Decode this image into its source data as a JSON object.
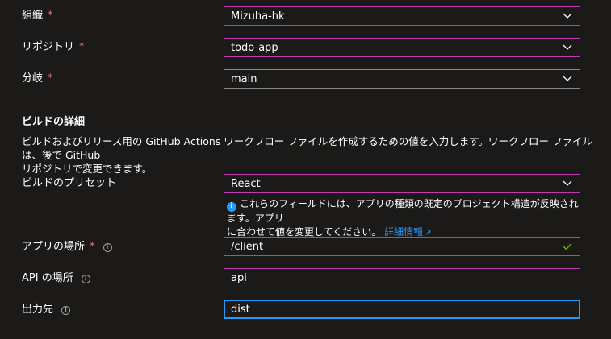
{
  "fields": {
    "org": {
      "label": "組織",
      "value": "Mizuha-hk",
      "required": "*"
    },
    "repo": {
      "label": "リポジトリ",
      "value": "todo-app",
      "required": "*"
    },
    "branch": {
      "label": "分岐",
      "value": "main",
      "required": "*"
    }
  },
  "build_details": {
    "title": "ビルドの詳細",
    "description_line1": "ビルドおよびリリース用の GitHub Actions ワークフロー ファイルを作成するための値を入力します。ワークフロー ファイルは、後で GitHub",
    "description_line2": "リポジトリで変更できます。",
    "preset": {
      "label": "ビルドのプリセット",
      "value": "React"
    },
    "hint": {
      "text_line1": "これらのフィールドには、アプリの種類の既定のプロジェクト構造が反映されます。アプリ",
      "text_line2": "に合わせて値を変更してください。",
      "link": "詳細情報"
    },
    "app_location": {
      "label": "アプリの場所",
      "value": "/client",
      "required": "*"
    },
    "api_location": {
      "label": "API の場所",
      "value": "api"
    },
    "output_location": {
      "label": "出力先",
      "value": "dist"
    }
  },
  "icons": {
    "chevron": "chevron-down-icon",
    "info": "info-icon",
    "check": "checkmark-icon",
    "external": "external-link-icon"
  },
  "colors": {
    "background": "#1b1a19",
    "field_border": "#c239b3",
    "focus_border": "#2899f5",
    "required": "#f1707b",
    "link": "#2899f5",
    "valid": "#6bb700"
  }
}
